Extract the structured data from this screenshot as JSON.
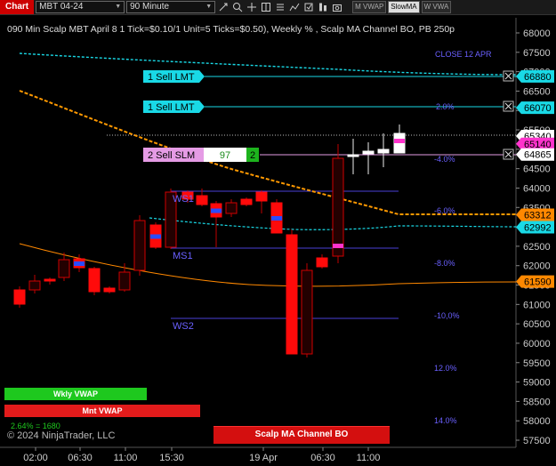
{
  "toolbar": {
    "chart_label": "Chart",
    "instrument": "MBT 04-24",
    "interval": "90 Minute",
    "buttons": [
      "M VWAP",
      "SlowMA",
      "W VWA"
    ],
    "active_button": 1
  },
  "title": "090 Min Scalp MBT April 8 1 Tick=$0.10/1 Unit=5 Ticks=$0.50), Weekly % , Scalp MA Channel BO, PB 250p",
  "copyright": "© 2024 NinjaTrader, LLC",
  "close_label": "CLOSE 12 APR",
  "price_axis": {
    "ticks": [
      "68000",
      "67500",
      "67000",
      "66500",
      "66000",
      "65500",
      "65000",
      "64500",
      "64000",
      "63500",
      "63000",
      "62500",
      "62000",
      "61500",
      "61000",
      "60500",
      "60000",
      "59500",
      "59000",
      "58500",
      "58000",
      "57500"
    ],
    "markers": [
      {
        "text": "66880",
        "color": "#19d9e6"
      },
      {
        "text": "66070",
        "color": "#19d9e6"
      },
      {
        "text": "65340",
        "color": "#ffffff"
      },
      {
        "text": "65140",
        "color": "#ff33cc"
      },
      {
        "text": "64865",
        "color": "#ffffff"
      },
      {
        "text": "63312",
        "color": "#ff8800"
      },
      {
        "text": "62992",
        "color": "#19d9e6"
      },
      {
        "text": "61590",
        "color": "#ff8800"
      }
    ]
  },
  "time_axis": {
    "ticks": [
      "02:00",
      "06:30",
      "11:00",
      "15:30",
      "19 Apr",
      "06:30",
      "11:00"
    ]
  },
  "orders": [
    {
      "label": "1 Sell LMT",
      "price": "66880",
      "color": "#19d9e6"
    },
    {
      "label": "1 Sell LMT",
      "price": "66070",
      "color": "#19d9e6"
    },
    {
      "label": "2 Sell SLM",
      "price": "64865",
      "color": "#e59be5",
      "qty_field": "97",
      "qty_badge": "2"
    }
  ],
  "percent_levels": [
    "2.0%",
    "-4.0%",
    "-6.0%",
    "-8.0%",
    "-10,0%",
    "12.0%",
    "14.0%"
  ],
  "level_labels": [
    "WS1",
    "MS1",
    "WS2"
  ],
  "strips": {
    "weekly_vwap": "Wkly VWAP",
    "monthly_vwap": "Mnt VWAP",
    "stat": "2.64% = 1680",
    "scalp": "Scalp MA Channel BO"
  },
  "colors": {
    "bull": "#000000",
    "bear": "#ff0000",
    "wick": "#d00000",
    "axis_bg": "#000000",
    "vwap_line": "#19d9e6",
    "slow_ma": "#ff9900"
  },
  "icons": [
    "draw-icon",
    "zoom-icon",
    "crosshair-icon",
    "tile-icon",
    "properties-icon",
    "indicators-icon",
    "strategies-icon",
    "dom-icon",
    "camera-icon"
  ]
}
